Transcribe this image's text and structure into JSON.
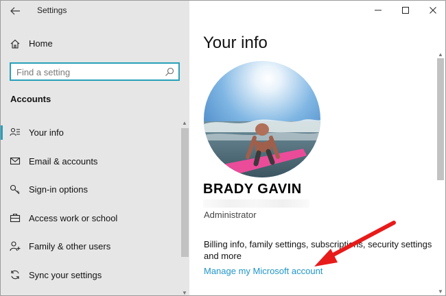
{
  "titlebar": {
    "app_title": "Settings"
  },
  "sidebar": {
    "home_label": "Home",
    "search": {
      "placeholder": "Find a setting"
    },
    "section_heading": "Accounts",
    "items": [
      {
        "label": "Your info",
        "icon": "person-card-icon",
        "active": true
      },
      {
        "label": "Email & accounts",
        "icon": "mail-icon",
        "active": false
      },
      {
        "label": "Sign-in options",
        "icon": "key-icon",
        "active": false
      },
      {
        "label": "Access work or school",
        "icon": "briefcase-icon",
        "active": false
      },
      {
        "label": "Family & other users",
        "icon": "person-add-icon",
        "active": false
      },
      {
        "label": "Sync your settings",
        "icon": "sync-icon",
        "active": false
      }
    ]
  },
  "main": {
    "page_title": "Your info",
    "user_name": "BRADY GAVIN",
    "role": "Administrator",
    "billing_text": "Billing info, family settings, subscriptions, security settings and more",
    "manage_link": "Manage my Microsoft account"
  },
  "colors": {
    "accent": "#27a0b9",
    "link": "#2196c9",
    "sidebar_bg": "#e6e6e6",
    "annotation_arrow": "#e81b1b"
  }
}
